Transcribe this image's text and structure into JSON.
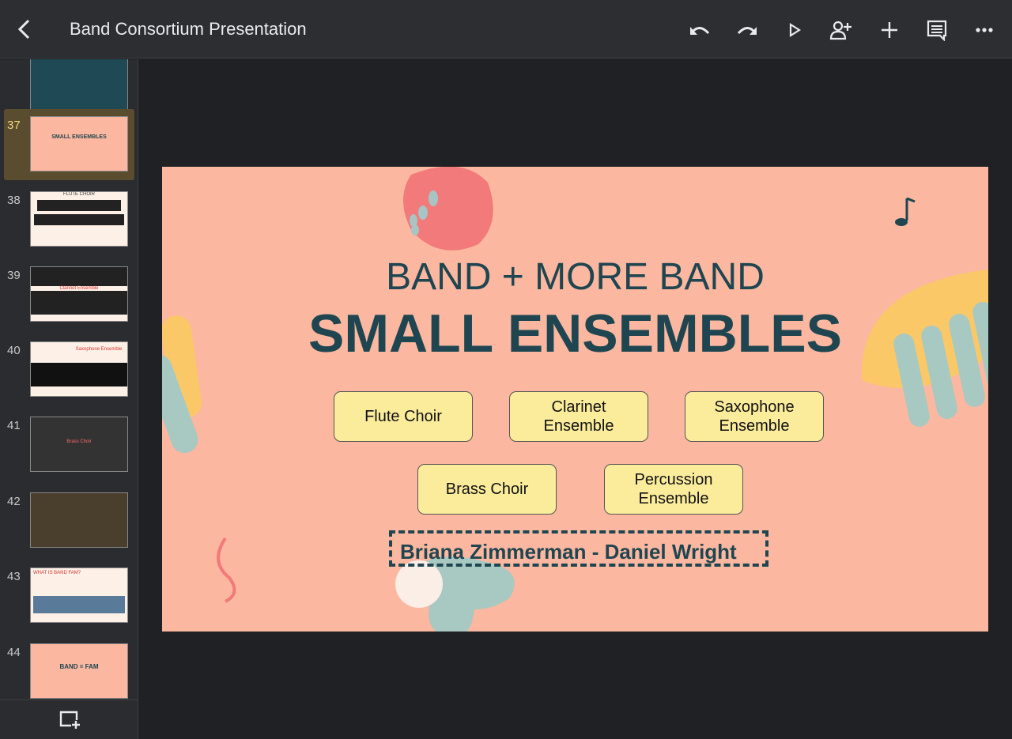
{
  "header": {
    "title": "Band Consortium Presentation"
  },
  "toolbar": [
    "undo",
    "redo",
    "present",
    "share",
    "insert",
    "comments",
    "more"
  ],
  "sidebar": {
    "slides": [
      {
        "num": "",
        "label": ""
      },
      {
        "num": "37",
        "label": "SMALL ENSEMBLES",
        "selected": true
      },
      {
        "num": "38",
        "label": "FLUTE CHOIR"
      },
      {
        "num": "39",
        "label": "Clarinet Ensemble"
      },
      {
        "num": "40",
        "label": "Saxophone Ensemble"
      },
      {
        "num": "41",
        "label": "Brass Choir"
      },
      {
        "num": "42",
        "label": ""
      },
      {
        "num": "43",
        "label": "WHAT IS BAND FAM?"
      },
      {
        "num": "44",
        "label": "BAND = FAM"
      }
    ]
  },
  "slide": {
    "line1": "BAND + MORE BAND",
    "line2": "SMALL ENSEMBLES",
    "ensembles": [
      "Flute Choir",
      "Clarinet\nEnsemble",
      "Saxophone\nEnsemble",
      "Brass Choir",
      "Percussion\nEnsemble"
    ],
    "presenters": "Briana Zimmerman - Daniel Wright"
  },
  "colors": {
    "slide_bg": "#fbb7a0",
    "text": "#1f4650",
    "pill": "#fbec9c",
    "selected": "#5a4c2e"
  }
}
